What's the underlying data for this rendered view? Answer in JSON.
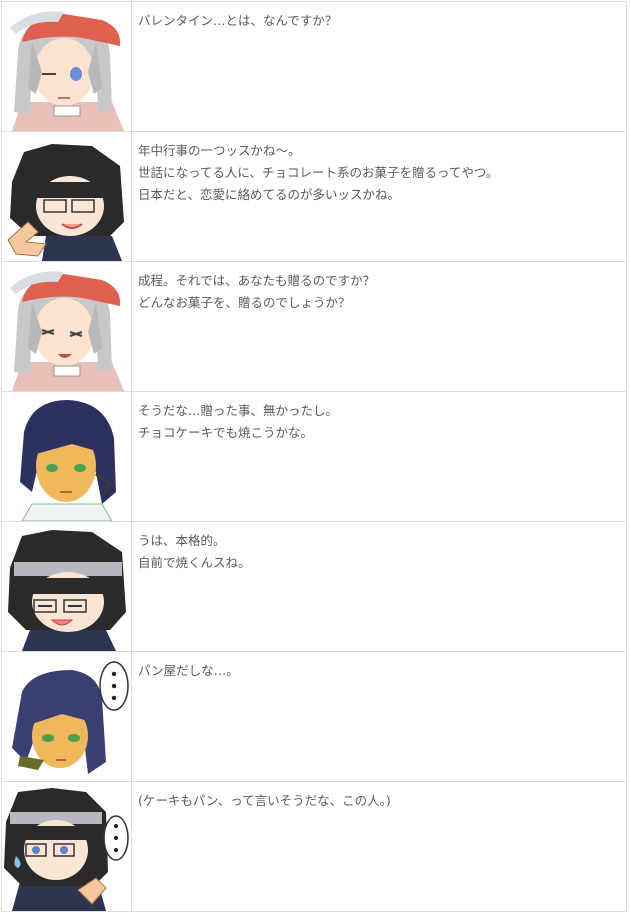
{
  "rows": [
    {
      "speaker_icon": "white-haired-girl-red-cap-avatar",
      "lines": [
        "バレンタイン…とは、なんですか？"
      ]
    },
    {
      "speaker_icon": "black-haired-glasses-girl-pointing-avatar",
      "lines": [
        "年中行事の一つッスかね〜。",
        "世話になってる人に、チョコレート系のお菓子を贈るってやつ。",
        "日本だと、恋愛に絡めてるのが多いッスかね。"
      ]
    },
    {
      "speaker_icon": "white-haired-girl-red-cap-smiling-avatar",
      "lines": [
        "成程。それでは、あなたも贈るのですか？",
        "どんなお菓子を、贈るのでしょうか？"
      ]
    },
    {
      "speaker_icon": "navy-haired-boy-avatar",
      "lines": [
        "そうだな…贈った事、無かったし。",
        "チョコケーキでも焼こうかな。"
      ]
    },
    {
      "speaker_icon": "black-haired-glasses-girl-smiling-avatar",
      "lines": [
        "うは、本格的。",
        "自前で焼くんスね。"
      ]
    },
    {
      "speaker_icon": "navy-haired-boy-thinking-avatar",
      "lines": [
        "パン屋だしな…。"
      ]
    },
    {
      "speaker_icon": "black-haired-glasses-girl-sweat-avatar",
      "lines": [
        "(ケーキもパン、って言いそうだな、この人。)"
      ]
    }
  ]
}
